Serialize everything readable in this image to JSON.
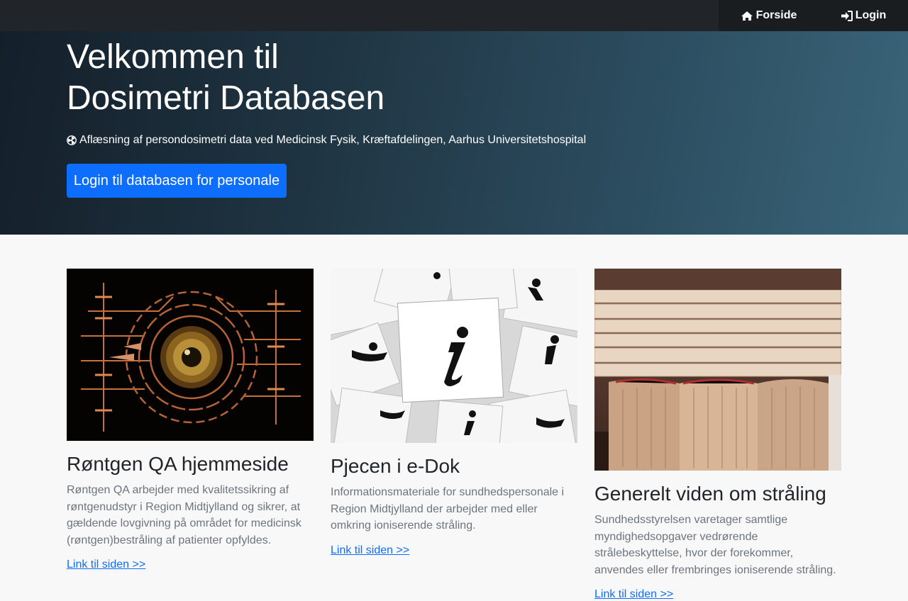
{
  "nav": {
    "home_label": "Forside",
    "login_label": "Login"
  },
  "hero": {
    "title_line1": "Velkommen til",
    "title_line2": "Dosimetri Databasen",
    "subtitle": "Aflæsning af persondosimetri data ved Medicinsk Fysik, Kræftafdelingen, Aarhus Universitetshospital",
    "button_label": "Login til databasen for personale"
  },
  "cards": [
    {
      "title": "Røntgen QA hjemmeside",
      "text": "Røntgen QA arbejder med kvalitetssikring af røntgenudstyr i Region Midtjylland og sikrer, at gældende lovgivning på området for medicinsk (røntgen)bestråling af patienter opfyldes.",
      "link": "Link til siden >>"
    },
    {
      "title": "Pjecen i e-Dok",
      "text": "Informationsmateriale for sundhedspersonale i Region Midtjylland der arbejder med eller omkring ioniserende stråling.",
      "link": "Link til siden >>"
    },
    {
      "title": "Generelt viden om stråling",
      "text": "Sundhedsstyrelsen varetager samtlige myndighedsopgaver vedrørende strålebeskyttelse, hvor der forekommer, anvendes eller frembringes ioniserende stråling.",
      "link": "Link til siden >>"
    }
  ],
  "colors": {
    "navbar": "#212529",
    "primary": "#0d6efd",
    "muted": "#6c757d"
  },
  "icons": {
    "home": "home-icon",
    "login": "sign-in-icon",
    "radiation": "radiation-icon"
  }
}
